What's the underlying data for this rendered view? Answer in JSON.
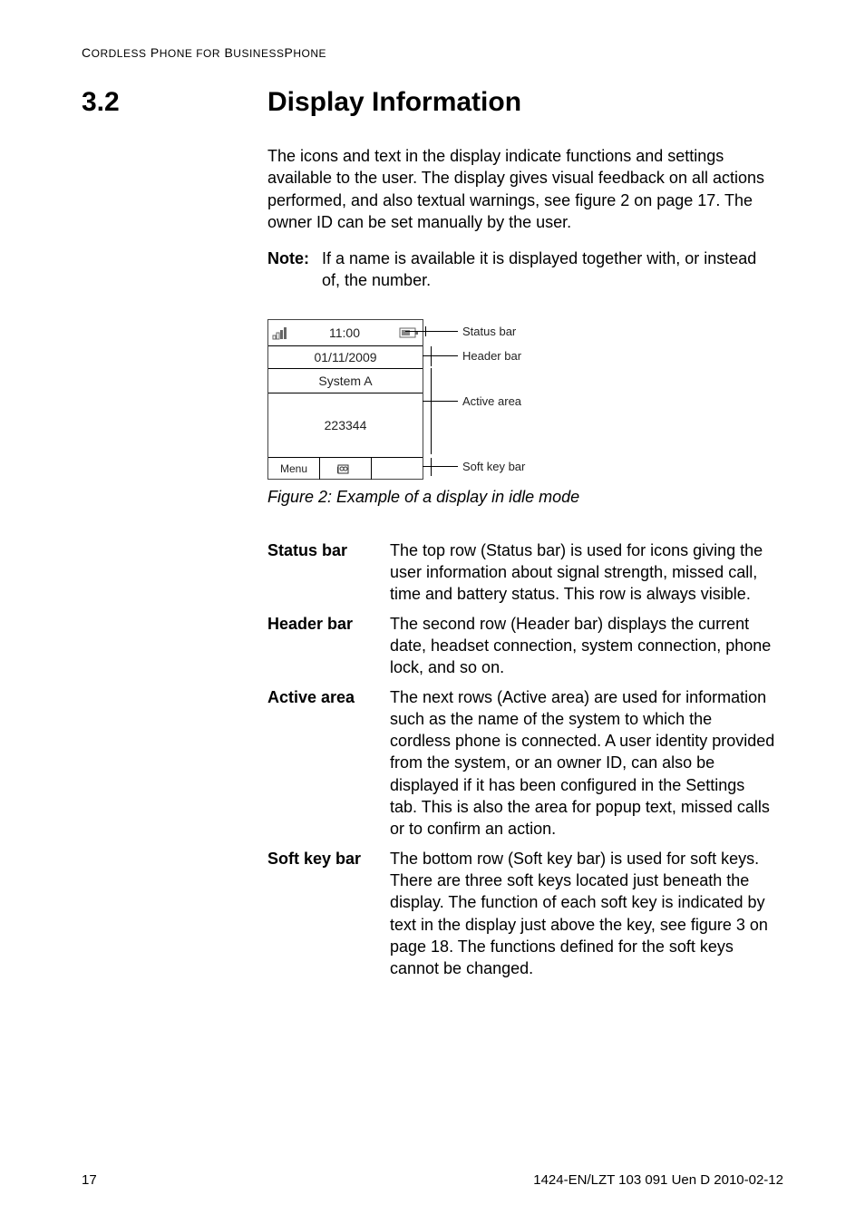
{
  "running_header": "Cordless Phone for BusinessPhone",
  "section": {
    "number": "3.2",
    "title": "Display Information"
  },
  "intro": "The icons and text in the display indicate functions and settings available to the user. The display gives visual feedback on all actions performed, and also textual warnings, see figure 2 on page 17. The owner ID can be set manually by the user.",
  "note": {
    "label": "Note:",
    "text": "If a name is available it is displayed together with, or instead of, the number."
  },
  "phone": {
    "clock": "11:00",
    "date": "01/11/2009",
    "system": "System A",
    "owner": "223344",
    "softkeys": [
      "Menu",
      "",
      ""
    ]
  },
  "labels": {
    "status": "Status bar",
    "header": "Header bar",
    "active": "Active area",
    "softkey": "Soft key bar"
  },
  "caption": "Figure 2:  Example of a display in idle mode",
  "defs": [
    {
      "term": "Status bar",
      "text": "The top row (Status bar) is used for icons giving the user information about signal strength, missed call, time and battery status. This row is always visible."
    },
    {
      "term": "Header bar",
      "text": "The second row (Header bar) displays the current date, headset connection, system connection, phone lock, and so on."
    },
    {
      "term": "Active area",
      "text": "The next rows (Active area) are used for information such as the name of the system to which the cordless phone is connected. A user identity provided from the system, or an owner ID, can also be displayed if it has been configured in the Settings tab. This is also the area for popup text, missed calls or to confirm an action."
    },
    {
      "term": "Soft key bar",
      "text": "The bottom row (Soft key bar) is used for soft keys. There are three soft keys located just beneath the display. The function of each soft key is indicated by text in the display just above the key, see figure 3 on page 18. The functions defined for the soft keys cannot be changed."
    }
  ],
  "footer": {
    "page": "17",
    "docid": "1424-EN/LZT 103 091 Uen D 2010-02-12"
  }
}
